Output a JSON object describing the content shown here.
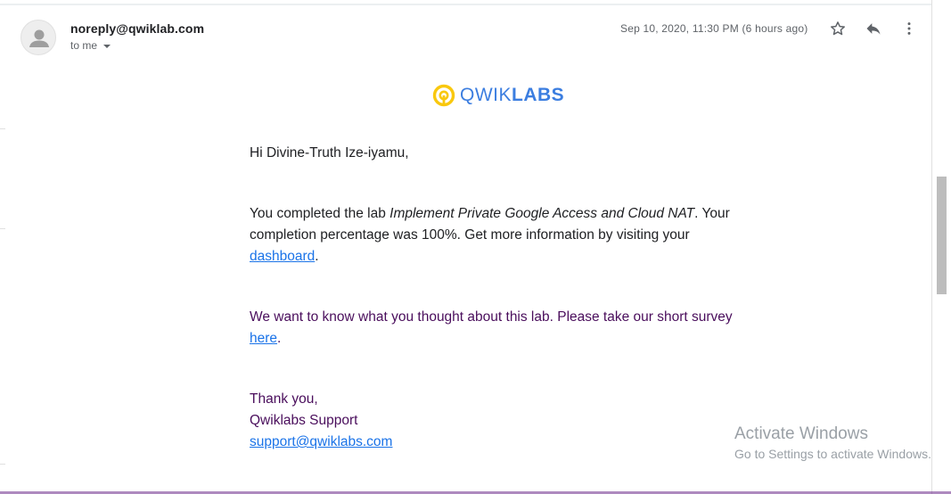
{
  "email": {
    "sender": "noreply@qwiklab.com",
    "recipient_label": "to me",
    "date": "Sep 10, 2020, 11:30 PM (6 hours ago)"
  },
  "logo": {
    "prefix": "QWIK",
    "suffix": "LABS"
  },
  "body": {
    "greeting": "Hi Divine-Truth Ize-iyamu,",
    "para1_before": "You completed the lab ",
    "para1_lab": "Implement Private Google Access and Cloud NAT",
    "para1_after": ". Your completion percentage was 100%. Get more information by visiting your ",
    "para1_link": "dashboard",
    "para1_end": ".",
    "para2_before": "We want to know what you thought about this lab. Please take our short survey ",
    "para2_link": "here",
    "para2_end": ".",
    "signoff": "Thank you,",
    "team": "Qwiklabs Support",
    "support_email": "support@qwiklabs.com"
  },
  "watermark": {
    "title": "Activate Windows",
    "subtitle": "Go to Settings to activate Windows."
  },
  "icons": [
    "avatar-icon",
    "caret-down-icon",
    "star-icon",
    "reply-icon",
    "more-vert-icon",
    "qwiklabs-logo-icon"
  ],
  "colors": {
    "logo_blue": "#3c7ee0",
    "logo_yellow": "#f9c80e",
    "link_blue": "#1a73e8",
    "purple_text": "#4a0e5c"
  }
}
